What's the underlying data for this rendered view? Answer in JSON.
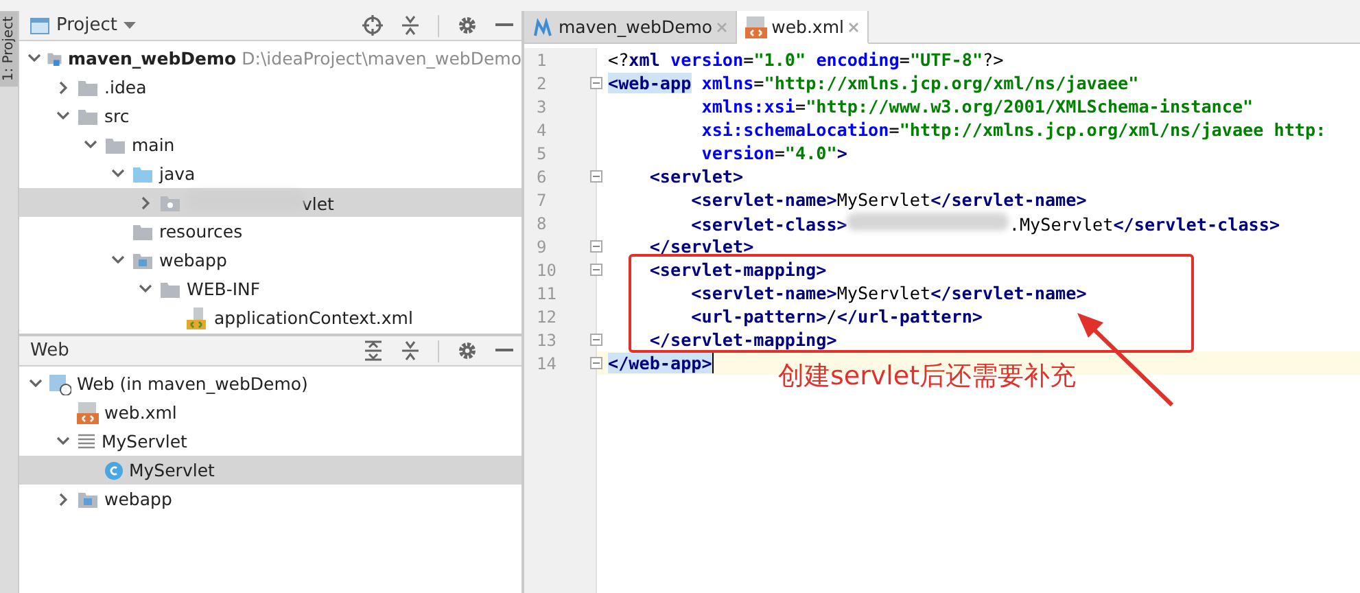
{
  "side_strip": {
    "label": "1: Project"
  },
  "project_panel": {
    "title": "Project",
    "tree": [
      {
        "label": "maven_webDemo",
        "hint": "D:\\ideaProject\\maven_webDemo",
        "kind": "module",
        "expanded": true,
        "selected": false,
        "children": [
          {
            "label": ".idea",
            "kind": "folder",
            "expanded": false,
            "selected": false
          },
          {
            "label": "src",
            "kind": "folder",
            "expanded": true,
            "selected": false,
            "children": [
              {
                "label": "main",
                "kind": "folder",
                "expanded": true,
                "selected": false,
                "children": [
                  {
                    "label": "java",
                    "kind": "source-folder",
                    "expanded": true,
                    "selected": false,
                    "children": [
                      {
                        "label": "vlet",
                        "kind": "package",
                        "redacted": true,
                        "expanded": false,
                        "selected": true
                      }
                    ]
                  },
                  {
                    "label": "resources",
                    "kind": "folder",
                    "selected": false
                  },
                  {
                    "label": "webapp",
                    "kind": "web-folder",
                    "expanded": true,
                    "selected": false,
                    "children": [
                      {
                        "label": "WEB-INF",
                        "kind": "folder",
                        "expanded": true,
                        "selected": false,
                        "children": [
                          {
                            "label": "applicationContext.xml",
                            "kind": "spring-xml",
                            "selected": false
                          }
                        ]
                      }
                    ]
                  }
                ]
              }
            ]
          }
        ]
      }
    ]
  },
  "web_panel": {
    "title": "Web",
    "tree": [
      {
        "label": "Web (in maven_webDemo)",
        "kind": "web-facet",
        "expanded": true,
        "selected": false,
        "children": [
          {
            "label": "web.xml",
            "kind": "xml",
            "selected": false
          },
          {
            "label": "MyServlet",
            "kind": "servlet-group",
            "expanded": true,
            "selected": false,
            "children": [
              {
                "label": "MyServlet",
                "kind": "class",
                "selected": true
              }
            ]
          },
          {
            "label": "webapp",
            "kind": "web-folder",
            "expanded": false,
            "selected": false
          }
        ]
      }
    ]
  },
  "editor": {
    "tabs": [
      {
        "label": "maven_webDemo",
        "kind": "maven",
        "selected": false
      },
      {
        "label": "web.xml",
        "kind": "xml",
        "selected": true
      }
    ],
    "lines": [
      {
        "number": "1",
        "fold": false,
        "current": false,
        "tokens": [
          {
            "kind": "punct",
            "text": "<?"
          },
          {
            "kind": "tag",
            "text": "xml "
          },
          {
            "kind": "attr",
            "text": "version"
          },
          {
            "kind": "punct",
            "text": "="
          },
          {
            "kind": "value",
            "text": "\"1.0\" "
          },
          {
            "kind": "attr",
            "text": "encoding"
          },
          {
            "kind": "punct",
            "text": "="
          },
          {
            "kind": "value",
            "text": "\"UTF-8\""
          },
          {
            "kind": "punct",
            "text": "?>"
          }
        ]
      },
      {
        "number": "2",
        "fold": true,
        "current": false,
        "tokens": [
          {
            "kind": "tag",
            "text": "<web-app",
            "matched": true
          },
          {
            "kind": "attr",
            "text": " xmlns"
          },
          {
            "kind": "punct",
            "text": "="
          },
          {
            "kind": "value",
            "text": "\"http://xmlns.jcp.org/xml/ns/javaee\""
          }
        ]
      },
      {
        "number": "3",
        "fold": false,
        "current": false,
        "tokens": [
          {
            "kind": "attr",
            "text": "         xmlns:xsi"
          },
          {
            "kind": "punct",
            "text": "="
          },
          {
            "kind": "value",
            "text": "\"http://www.w3.org/2001/XMLSchema-instance\""
          }
        ]
      },
      {
        "number": "4",
        "fold": false,
        "current": false,
        "tokens": [
          {
            "kind": "attr",
            "text": "         xsi:schemaLocation"
          },
          {
            "kind": "punct",
            "text": "="
          },
          {
            "kind": "value",
            "text": "\"http://xmlns.jcp.org/xml/ns/javaee http:"
          }
        ]
      },
      {
        "number": "5",
        "fold": false,
        "current": false,
        "tokens": [
          {
            "kind": "attr",
            "text": "         version"
          },
          {
            "kind": "punct",
            "text": "="
          },
          {
            "kind": "value",
            "text": "\"4.0\""
          },
          {
            "kind": "tag",
            "text": ">"
          }
        ]
      },
      {
        "number": "6",
        "fold": true,
        "current": false,
        "tokens": [
          {
            "kind": "tag",
            "text": "    <servlet>"
          }
        ]
      },
      {
        "number": "7",
        "fold": false,
        "current": false,
        "tokens": [
          {
            "kind": "tag",
            "text": "        <servlet-name>"
          },
          {
            "kind": "text",
            "text": "MyServlet"
          },
          {
            "kind": "tag",
            "text": "</servlet-name>"
          }
        ]
      },
      {
        "number": "8",
        "fold": false,
        "current": false,
        "tokens": [
          {
            "kind": "tag",
            "text": "        <servlet-class>"
          },
          {
            "kind": "redacted"
          },
          {
            "kind": "text",
            "text": ".MyServlet"
          },
          {
            "kind": "tag",
            "text": "</servlet-class>"
          }
        ]
      },
      {
        "number": "9",
        "fold": true,
        "current": false,
        "tokens": [
          {
            "kind": "tag",
            "text": "    </servlet>"
          }
        ]
      },
      {
        "number": "10",
        "fold": true,
        "current": false,
        "tokens": [
          {
            "kind": "tag",
            "text": "    <servlet-mapping>"
          }
        ]
      },
      {
        "number": "11",
        "fold": false,
        "current": false,
        "tokens": [
          {
            "kind": "tag",
            "text": "        <servlet-name>"
          },
          {
            "kind": "text",
            "text": "MyServlet"
          },
          {
            "kind": "tag",
            "text": "</servlet-name>"
          }
        ]
      },
      {
        "number": "12",
        "fold": false,
        "current": false,
        "tokens": [
          {
            "kind": "tag",
            "text": "        <url-pattern>"
          },
          {
            "kind": "text",
            "text": "/"
          },
          {
            "kind": "tag",
            "text": "</url-pattern>"
          }
        ]
      },
      {
        "number": "13",
        "fold": true,
        "current": false,
        "tokens": [
          {
            "kind": "tag",
            "text": "    </servlet-mapping>"
          }
        ]
      },
      {
        "number": "14",
        "fold": true,
        "current": true,
        "tokens": [
          {
            "kind": "tag",
            "text": "</web-app>",
            "matched": true
          }
        ]
      }
    ]
  },
  "annotation": {
    "text": "创建servlet后还需要补充"
  }
}
